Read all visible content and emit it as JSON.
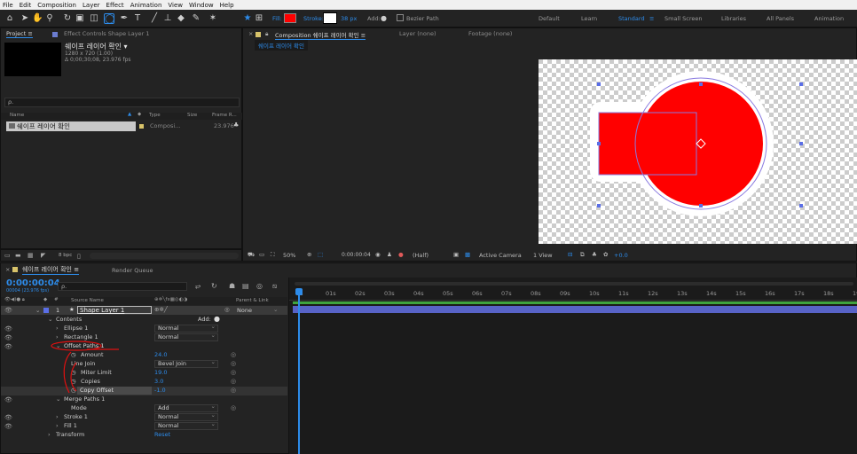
{
  "menu": [
    "File",
    "Edit",
    "Composition",
    "Layer",
    "Effect",
    "Animation",
    "View",
    "Window",
    "Help"
  ],
  "toolbar": {
    "fill_label": "Fill:",
    "fill_color": "#ff0000",
    "stroke_label": "Stroke:",
    "stroke_width": "38 px",
    "add_label": "Add:",
    "bezier_label": "Bezier Path",
    "workspaces": [
      "Default",
      "Learn",
      "Standard",
      "Small Screen",
      "Libraries",
      "All Panels",
      "Animation"
    ],
    "active_workspace": "Standard"
  },
  "project": {
    "tab": "Project",
    "effect_controls": "Effect Controls Shape Layer 1",
    "comp_name": "쉐이프 레이어 확인 ▾",
    "comp_size": "1280 x 720 (1.00)",
    "comp_duration": "Δ 0;00;30;08, 23.976 fps",
    "search_placeholder": "ρ.",
    "columns": [
      "Name",
      "Type",
      "Size",
      "Frame R..."
    ],
    "item_name": "쉐이프 레이어 확인",
    "item_type": "Composi...",
    "item_fps": "23.976",
    "bpc": "8 bpc"
  },
  "comp": {
    "tab_label": "Composition 쉐이프 레이어 확인",
    "layer_label": "Layer (none)",
    "footage_label": "Footage (none)",
    "breadcrumb": "쉐이프 레이어 확인",
    "zoom": "50%",
    "timecode": "0:00:00:04",
    "resolution": "(Half)",
    "camera": "Active Camera",
    "view": "1 View",
    "exposure": "+0.0"
  },
  "timeline": {
    "tab": "쉐이프 레이어 확인",
    "render_queue": "Render Queue",
    "timecode": "0:00:00:04",
    "timecode_sub": "00004 (23.976 fps)",
    "search_placeholder": "ρ.",
    "col_source": "Source Name",
    "col_parent": "Parent & Link",
    "layer_number": "1",
    "layer_name": "Shape Layer 1",
    "parent_value": "None",
    "contents": "Contents",
    "add": "Add:",
    "ellipse": "Ellipse 1",
    "ellipse_mode": "Normal",
    "rectangle": "Rectangle 1",
    "rectangle_mode": "Normal",
    "offset": "Offset Paths 1",
    "amount_label": "Amount",
    "amount_value": "24.0",
    "line_join_label": "Line Join",
    "line_join_value": "Bevel Join",
    "miter_label": "Miter Limit",
    "miter_value": "19.0",
    "copies_label": "Copies",
    "copies_value": "3.0",
    "copy_offset_label": "Copy Offset",
    "copy_offset_value": "-1.0",
    "merge": "Merge Paths 1",
    "merge_mode_label": "Mode",
    "merge_mode_value": "Add",
    "stroke": "Stroke 1",
    "stroke_mode": "Normal",
    "fill": "Fill 1",
    "fill_mode": "Normal",
    "transform": "Transform",
    "transform_reset": "Reset",
    "ruler": [
      "0s",
      "01s",
      "02s",
      "03s",
      "04s",
      "05s",
      "06s",
      "07s",
      "08s",
      "09s",
      "10s",
      "11s",
      "12s",
      "13s",
      "14s",
      "15s",
      "16s",
      "17s",
      "18s",
      "19s"
    ]
  }
}
